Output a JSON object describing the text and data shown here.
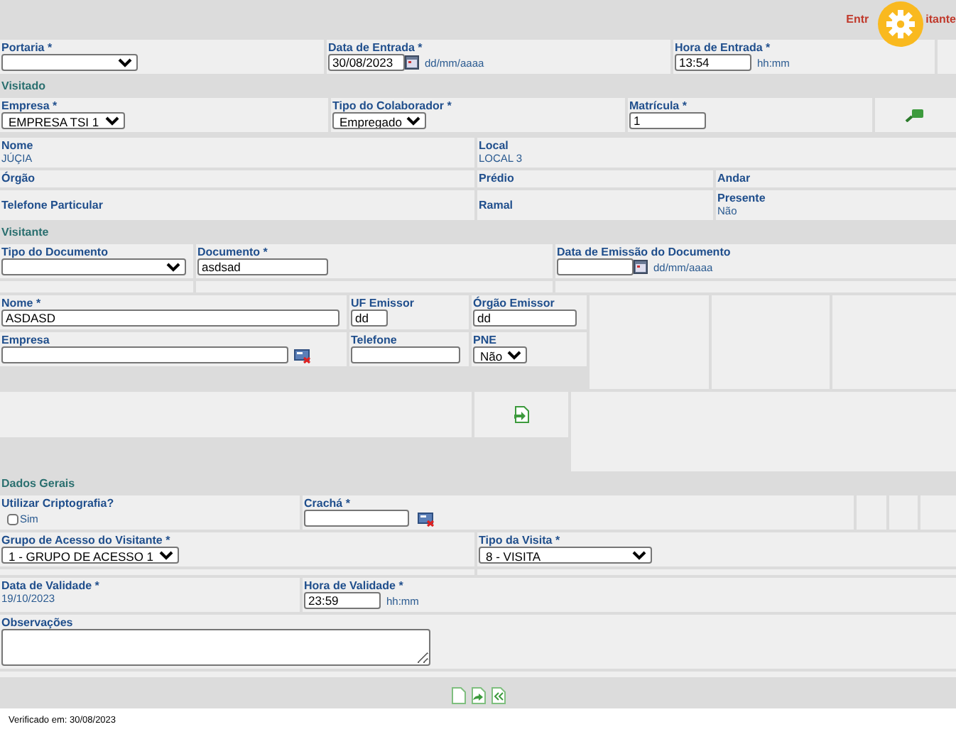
{
  "header": {
    "title_parts": [
      "Entr",
      "itante"
    ]
  },
  "entrada": {
    "portaria": {
      "label": "Portaria *"
    },
    "data": {
      "label": "Data de Entrada *",
      "value": "30/08/2023",
      "hint": "dd/mm/aaaa"
    },
    "hora": {
      "label": "Hora de Entrada *",
      "value": "13:54",
      "hint": "hh:mm"
    }
  },
  "visitado": {
    "title": "Visitado",
    "empresa": {
      "label": "Empresa *",
      "value": "EMPRESA TSI 1"
    },
    "tipo_colaborador": {
      "label": "Tipo do Colaborador *",
      "value": "Empregado"
    },
    "matricula": {
      "label": "Matrícula *",
      "value": "1"
    },
    "info": [
      {
        "label": "Nome",
        "value": "JÚÇIA"
      },
      {
        "label": "Local",
        "value": "LOCAL 3"
      },
      {
        "label": "Órgão"
      },
      {
        "label": "Prédio"
      },
      {
        "label": "Andar"
      },
      {
        "label": "Telefone Particular"
      },
      {
        "label": "Ramal"
      },
      {
        "label": "Presente",
        "value": "Não"
      }
    ]
  },
  "visitante": {
    "title": "Visitante",
    "tipo_documento": {
      "label": "Tipo do Documento"
    },
    "documento": {
      "label": "Documento *",
      "value": "asdsad"
    },
    "data_emissao": {
      "label": "Data de Emissão do Documento",
      "hint": "dd/mm/aaaa"
    },
    "nome": {
      "label": "Nome *",
      "value": "ASDASD"
    },
    "uf_emissor": {
      "label": "UF Emissor",
      "value": "dd"
    },
    "orgao_emissor": {
      "label": "Órgão Emissor",
      "value": "dd"
    },
    "empresa": {
      "label": "Empresa"
    },
    "telefone": {
      "label": "Telefone"
    },
    "pne": {
      "label": "PNE",
      "value": "Não"
    }
  },
  "dados_gerais": {
    "title": "Dados Gerais",
    "criptografia": {
      "label": "Utilizar Criptografia?",
      "option": "Sim",
      "checked": false
    },
    "cracha": {
      "label": "Crachá *"
    },
    "grupo": {
      "label": "Grupo de Acesso do Visitante *",
      "value": "1 - GRUPO DE ACESSO 1"
    },
    "tipo_visita": {
      "label": "Tipo da Visita *",
      "value": "8 - VISITA"
    },
    "data_validade": {
      "label": "Data de Validade *",
      "value": "19/10/2023"
    },
    "hora_validade": {
      "label": "Hora de Validade *",
      "value": "23:59",
      "hint": "hh:mm"
    },
    "observacoes": {
      "label": "Observações"
    }
  },
  "footer": {
    "verified": "Verificado em: 30/08/2023"
  }
}
